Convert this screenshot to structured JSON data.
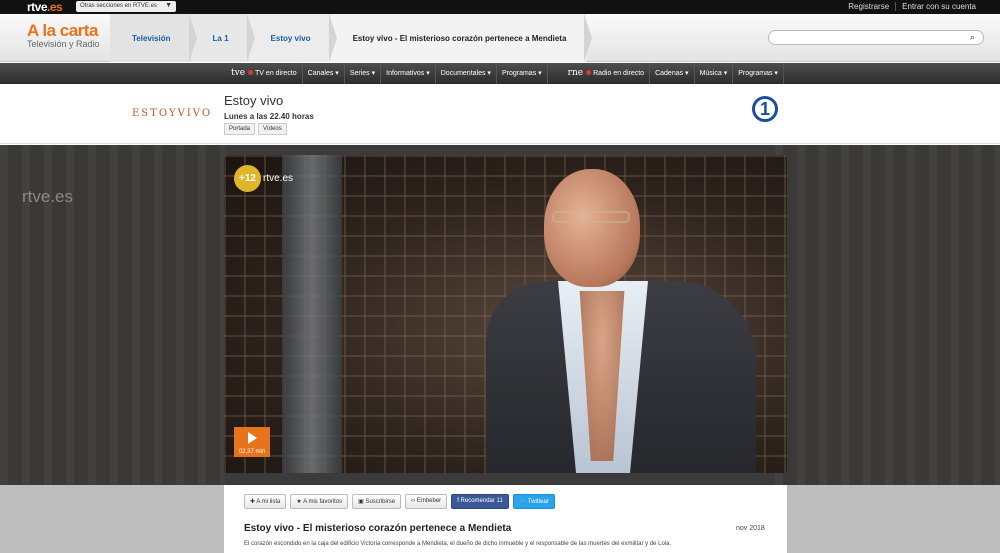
{
  "topbar": {
    "logo_text": "rtve",
    "logo_suffix": ".es",
    "sections_label": "Otras secciones en RTVE.es",
    "register": "Registrarse",
    "login": "Entrar con su cuenta"
  },
  "header": {
    "brand_title": "A la carta",
    "brand_subtitle": "Televisión y Radio",
    "breadcrumbs": [
      "Televisión",
      "La 1",
      "Estoy vivo",
      "Estoy vivo - El misterioso corazón pertenece a Mendieta"
    ],
    "search_placeholder": ""
  },
  "nav": {
    "tve_logo": "tve",
    "tv_live": "TV en directo",
    "tv_items": [
      "Canales",
      "Series",
      "Informativos",
      "Documentales",
      "Programas"
    ],
    "rne_logo": "rne",
    "radio_live": "Radio en directo",
    "radio_items": [
      "Cadenas",
      "Música",
      "Programas"
    ]
  },
  "program": {
    "logo_text": "ESTOYVIVO",
    "title": "Estoy vivo",
    "schedule": "Lunes a las 22.40 horas",
    "tabs": [
      "Portada",
      "Vídeos"
    ],
    "channel": "1"
  },
  "video": {
    "watermark": "rtve.es",
    "age_rating": "+12",
    "overlay_logo": "rtve.es",
    "duration": "02.37 min"
  },
  "actions": [
    "A mi lista",
    "A mis favoritos",
    "Suscribirse",
    "Embeber",
    "Recomendar 11",
    "Twittear"
  ],
  "article": {
    "title": "Estoy vivo - El misterioso corazón pertenece a Mendieta",
    "date": "nov 2018",
    "description": "El corazón escondido en la caja del edificio Victoria corresponde a Mendieta, el dueño de dicho inmueble y el responsable de las muertes del exmilitar y de Lola."
  },
  "colors": {
    "accent": "#e8731d",
    "link": "#1a5fa6",
    "facebook": "#3b5998",
    "twitter": "#2aa3ef"
  }
}
